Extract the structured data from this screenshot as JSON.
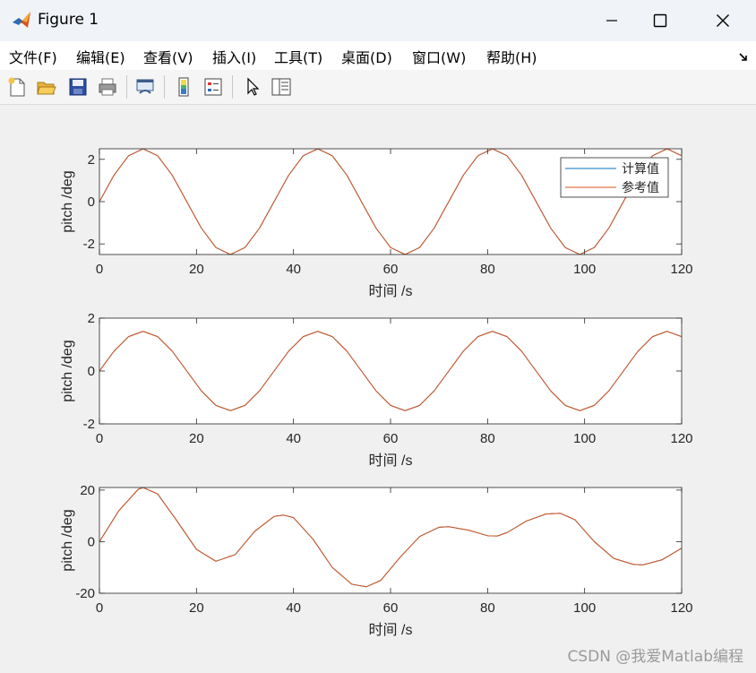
{
  "window": {
    "title": "Figure 1",
    "buttons": [
      "minimize",
      "maximize",
      "close"
    ]
  },
  "menu": {
    "items": [
      "文件(F)",
      "编辑(E)",
      "查看(V)",
      "插入(I)",
      "工具(T)",
      "桌面(D)",
      "窗口(W)",
      "帮助(H)"
    ],
    "dock_icon": "dock-arrow-icon"
  },
  "toolbar": {
    "icons": [
      "new-figure-icon",
      "open-file-icon",
      "save-icon",
      "print-icon",
      "link-plot-icon",
      "insert-colorbar-icon",
      "insert-legend-icon",
      "edit-plot-icon",
      "property-inspector-icon"
    ]
  },
  "colors": {
    "series_computed": "#0072BD",
    "series_reference": "#D95319",
    "axes": "#262626",
    "window_bg": "#f0f0f0"
  },
  "chart_data": [
    {
      "type": "line",
      "xlabel": "时间 /s",
      "ylabel": "pitch /deg",
      "xlim": [
        0,
        120
      ],
      "ylim": [
        -2.5,
        2.5
      ],
      "xticks": [
        "0",
        "20",
        "40",
        "60",
        "80",
        "100",
        "120"
      ],
      "yticks": [
        "-2",
        "0",
        "2"
      ],
      "ytick_values": [
        -2,
        0,
        2
      ],
      "legend": {
        "location": "top-right",
        "entries": [
          "计算值",
          "参考值"
        ]
      },
      "series": [
        {
          "name": "计算值",
          "x": [
            0,
            3,
            6,
            9,
            12,
            15,
            18,
            21,
            24,
            27,
            30,
            33,
            36,
            39,
            42,
            45,
            48,
            51,
            54,
            57,
            60,
            63,
            66,
            69,
            72,
            75,
            78,
            81,
            84,
            87,
            90,
            93,
            96,
            99,
            102,
            105,
            108,
            111,
            114,
            117,
            120
          ],
          "values": [
            0,
            1.25,
            2.17,
            2.5,
            2.17,
            1.25,
            0,
            -1.25,
            -2.17,
            -2.5,
            -2.17,
            -1.25,
            0,
            1.25,
            2.17,
            2.5,
            2.17,
            1.25,
            0,
            -1.25,
            -2.17,
            -2.5,
            -2.17,
            -1.25,
            0,
            1.25,
            2.17,
            2.5,
            2.17,
            1.25,
            0,
            -1.25,
            -2.17,
            -2.5,
            -2.17,
            -1.25,
            0,
            1.25,
            2.17,
            2.5,
            2.17
          ]
        },
        {
          "name": "参考值",
          "x": [
            0,
            3,
            6,
            9,
            12,
            15,
            18,
            21,
            24,
            27,
            30,
            33,
            36,
            39,
            42,
            45,
            48,
            51,
            54,
            57,
            60,
            63,
            66,
            69,
            72,
            75,
            78,
            81,
            84,
            87,
            90,
            93,
            96,
            99,
            102,
            105,
            108,
            111,
            114,
            117,
            120
          ],
          "values": [
            0,
            1.25,
            2.17,
            2.5,
            2.17,
            1.25,
            0,
            -1.25,
            -2.17,
            -2.5,
            -2.17,
            -1.25,
            0,
            1.25,
            2.17,
            2.5,
            2.17,
            1.25,
            0,
            -1.25,
            -2.17,
            -2.5,
            -2.17,
            -1.25,
            0,
            1.25,
            2.17,
            2.5,
            2.17,
            1.25,
            0,
            -1.25,
            -2.17,
            -2.5,
            -2.17,
            -1.25,
            0,
            1.25,
            2.17,
            2.5,
            2.17
          ]
        }
      ]
    },
    {
      "type": "line",
      "xlabel": "时间 /s",
      "ylabel": "pitch /deg",
      "xlim": [
        0,
        120
      ],
      "ylim": [
        -2,
        2
      ],
      "xticks": [
        "0",
        "20",
        "40",
        "60",
        "80",
        "100",
        "120"
      ],
      "yticks": [
        "-2",
        "0",
        "2"
      ],
      "ytick_values": [
        -2,
        0,
        2
      ],
      "series": [
        {
          "x": [
            0,
            3,
            6,
            9,
            12,
            15,
            18,
            21,
            24,
            27,
            30,
            33,
            36,
            39,
            42,
            45,
            48,
            51,
            54,
            57,
            60,
            63,
            66,
            69,
            72,
            75,
            78,
            81,
            84,
            87,
            90,
            93,
            96,
            99,
            102,
            105,
            108,
            111,
            114,
            117,
            120
          ],
          "values": [
            0,
            0.75,
            1.3,
            1.5,
            1.3,
            0.75,
            0,
            -0.75,
            -1.3,
            -1.5,
            -1.3,
            -0.75,
            0,
            0.75,
            1.3,
            1.5,
            1.3,
            0.75,
            0,
            -0.75,
            -1.3,
            -1.5,
            -1.3,
            -0.75,
            0,
            0.75,
            1.3,
            1.5,
            1.3,
            0.75,
            0,
            -0.75,
            -1.3,
            -1.5,
            -1.3,
            -0.75,
            0,
            0.75,
            1.3,
            1.5,
            1.3
          ]
        },
        {
          "x": [
            0,
            3,
            6,
            9,
            12,
            15,
            18,
            21,
            24,
            27,
            30,
            33,
            36,
            39,
            42,
            45,
            48,
            51,
            54,
            57,
            60,
            63,
            66,
            69,
            72,
            75,
            78,
            81,
            84,
            87,
            90,
            93,
            96,
            99,
            102,
            105,
            108,
            111,
            114,
            117,
            120
          ],
          "values": [
            0,
            0.75,
            1.3,
            1.5,
            1.3,
            0.75,
            0,
            -0.75,
            -1.3,
            -1.5,
            -1.3,
            -0.75,
            0,
            0.75,
            1.3,
            1.5,
            1.3,
            0.75,
            0,
            -0.75,
            -1.3,
            -1.5,
            -1.3,
            -0.75,
            0,
            0.75,
            1.3,
            1.5,
            1.3,
            0.75,
            0,
            -0.75,
            -1.3,
            -1.5,
            -1.3,
            -0.75,
            0,
            0.75,
            1.3,
            1.5,
            1.3
          ]
        }
      ]
    },
    {
      "type": "line",
      "xlabel": "时间 /s",
      "ylabel": "pitch /deg",
      "xlim": [
        0,
        120
      ],
      "ylim": [
        -20,
        21
      ],
      "xticks": [
        "0",
        "20",
        "40",
        "60",
        "80",
        "100",
        "120"
      ],
      "yticks": [
        "-20",
        "0",
        "20"
      ],
      "ytick_values": [
        -20,
        0,
        20
      ],
      "series": [
        {
          "x": [
            0,
            4,
            8,
            9,
            12,
            16,
            20,
            24,
            28,
            32,
            36,
            38,
            40,
            44,
            48,
            52,
            55,
            58,
            62,
            66,
            70,
            72,
            76,
            80,
            82,
            84,
            88,
            92,
            95,
            98,
            102,
            106,
            110,
            112,
            116,
            120
          ],
          "values": [
            0,
            12,
            20.3,
            21,
            18.5,
            8,
            -3,
            -7.6,
            -5,
            4,
            9.8,
            10.3,
            9.3,
            1,
            -10,
            -16.5,
            -17.5,
            -15,
            -6,
            2,
            5.6,
            5.8,
            4.5,
            2.3,
            2.2,
            3.5,
            8,
            10.7,
            11,
            8.5,
            0,
            -6.5,
            -8.8,
            -9,
            -7,
            -2.5
          ]
        },
        {
          "x": [
            0,
            4,
            8,
            9,
            12,
            16,
            20,
            24,
            28,
            32,
            36,
            38,
            40,
            44,
            48,
            52,
            55,
            58,
            62,
            66,
            70,
            72,
            76,
            80,
            82,
            84,
            88,
            92,
            95,
            98,
            102,
            106,
            110,
            112,
            116,
            120
          ],
          "values": [
            0,
            12,
            20.3,
            21,
            18.5,
            8,
            -3,
            -7.6,
            -5,
            4,
            9.8,
            10.3,
            9.3,
            1,
            -10,
            -16.5,
            -17.5,
            -15,
            -6,
            2,
            5.6,
            5.8,
            4.5,
            2.3,
            2.2,
            3.5,
            8,
            10.7,
            11,
            8.5,
            0,
            -6.5,
            -8.8,
            -9,
            -7,
            -2.5
          ]
        }
      ]
    }
  ],
  "watermark": "CSDN @我爱Matlab编程"
}
